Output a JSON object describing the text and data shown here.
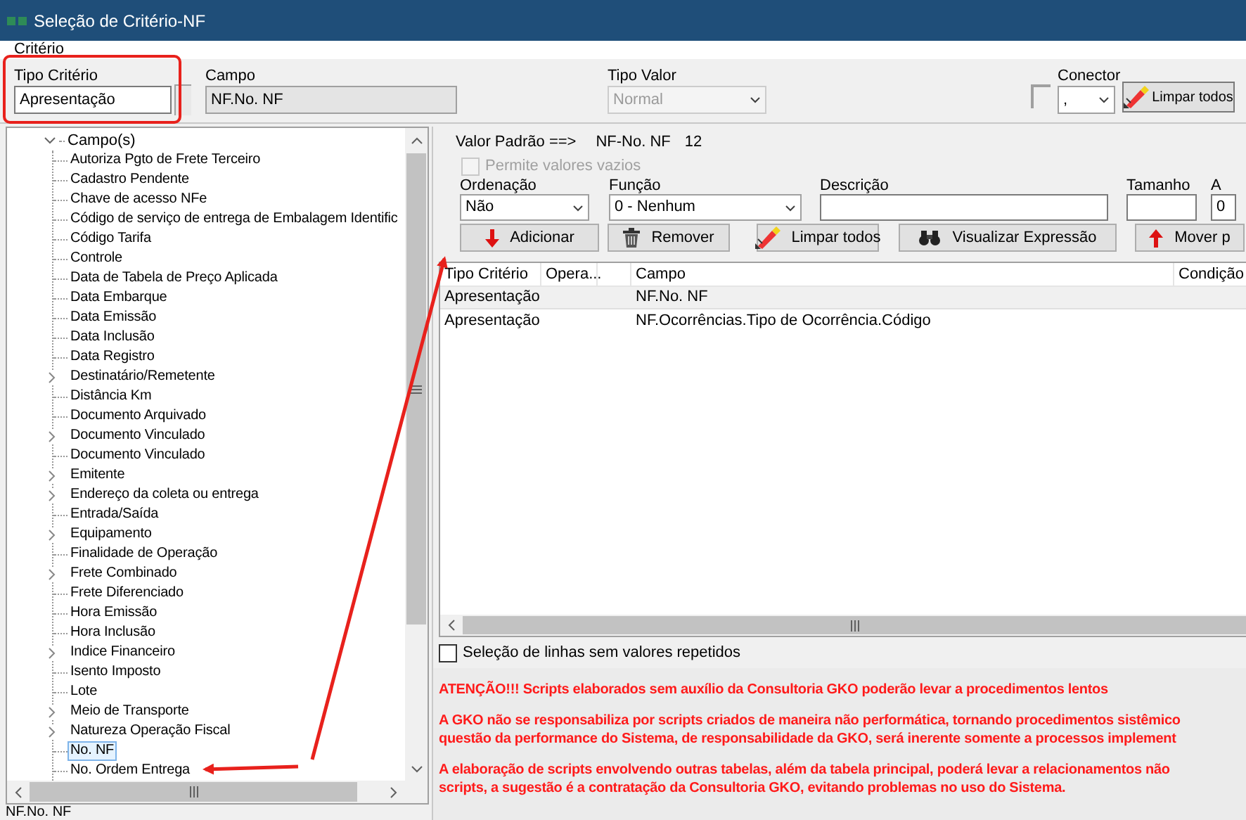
{
  "window": {
    "title": "Seleção de Critério-NF"
  },
  "menu": [
    {
      "label": "Critério"
    }
  ],
  "top_form": {
    "tipo_criterio": {
      "label": "Tipo Critério",
      "value": "Apresentação"
    },
    "campo": {
      "label": "Campo",
      "value": "NF.No. NF"
    },
    "tipo_valor": {
      "label": "Tipo Valor",
      "value": "Normal",
      "disabled": true
    },
    "conector": {
      "label": "Conector",
      "checked": false,
      "value": ","
    },
    "clear_button": {
      "label": "Limpar todos"
    }
  },
  "tree": {
    "label": "Campo(s)",
    "expanded": true,
    "children": [
      {
        "label": "Autoriza Pgto de Frete Terceiro",
        "expandable": false,
        "selected": false
      },
      {
        "label": "Cadastro Pendente",
        "expandable": false,
        "selected": false
      },
      {
        "label": "Chave de acesso NFe",
        "expandable": false,
        "selected": false
      },
      {
        "label": "Código de serviço de entrega de Embalagem Identific",
        "expandable": false,
        "selected": false
      },
      {
        "label": "Código Tarifa",
        "expandable": false,
        "selected": false
      },
      {
        "label": "Controle",
        "expandable": false,
        "selected": false
      },
      {
        "label": "Data de Tabela de Preço Aplicada",
        "expandable": false,
        "selected": false
      },
      {
        "label": "Data Embarque",
        "expandable": false,
        "selected": false
      },
      {
        "label": "Data Emissão",
        "expandable": false,
        "selected": false
      },
      {
        "label": "Data Inclusão",
        "expandable": false,
        "selected": false
      },
      {
        "label": "Data Registro",
        "expandable": false,
        "selected": false
      },
      {
        "label": "Destinatário/Remetente",
        "expandable": true,
        "selected": false
      },
      {
        "label": "Distância Km",
        "expandable": false,
        "selected": false
      },
      {
        "label": "Documento Arquivado",
        "expandable": false,
        "selected": false
      },
      {
        "label": "Documento Vinculado",
        "expandable": true,
        "selected": false
      },
      {
        "label": "Documento Vinculado",
        "expandable": false,
        "selected": false
      },
      {
        "label": "Emitente",
        "expandable": true,
        "selected": false
      },
      {
        "label": "Endereço da coleta ou entrega",
        "expandable": true,
        "selected": false
      },
      {
        "label": "Entrada/Saída",
        "expandable": false,
        "selected": false
      },
      {
        "label": "Equipamento",
        "expandable": true,
        "selected": false
      },
      {
        "label": "Finalidade de Operação",
        "expandable": false,
        "selected": false
      },
      {
        "label": "Frete Combinado",
        "expandable": true,
        "selected": false
      },
      {
        "label": "Frete Diferenciado",
        "expandable": false,
        "selected": false
      },
      {
        "label": "Hora Emissão",
        "expandable": false,
        "selected": false
      },
      {
        "label": "Hora Inclusão",
        "expandable": false,
        "selected": false
      },
      {
        "label": "Indice Financeiro",
        "expandable": true,
        "selected": false
      },
      {
        "label": "Isento Imposto",
        "expandable": false,
        "selected": false
      },
      {
        "label": "Lote",
        "expandable": false,
        "selected": false
      },
      {
        "label": "Meio de Transporte",
        "expandable": true,
        "selected": false
      },
      {
        "label": "Natureza Operação Fiscal",
        "expandable": true,
        "selected": false
      },
      {
        "label": "No. NF",
        "expandable": false,
        "selected": true
      },
      {
        "label": "No. Ordem Entrega",
        "expandable": false,
        "selected": false
      }
    ]
  },
  "status_text": "NF.No. NF",
  "default_value": {
    "label": "Valor Padrão ==>",
    "field": "NF-No. NF",
    "value": "12"
  },
  "allow_empty": {
    "label": "Permite valores vazios",
    "checked": false,
    "disabled": true
  },
  "fields": [
    {
      "kind": "select",
      "label": "Ordenação",
      "value": "Não"
    },
    {
      "kind": "select",
      "label": "Função",
      "value": "0 - Nenhum"
    },
    {
      "kind": "input",
      "label": "Descrição"
    },
    {
      "kind": "input",
      "label": "Tamanho"
    },
    {
      "kind": "input",
      "label": "A",
      "value": "0"
    }
  ],
  "buttons": [
    {
      "kind": "add",
      "label": "Adicionar"
    },
    {
      "kind": "remove",
      "label": "Remover"
    },
    {
      "kind": "clear",
      "label": "Limpar todos"
    },
    {
      "kind": "view",
      "label": "Visualizar Expressão"
    },
    {
      "kind": "move",
      "label": "Mover p"
    }
  ],
  "table": {
    "columns": [
      "Tipo Critério",
      "Opera...",
      "Campo",
      "Condição"
    ],
    "rows": [
      {
        "tipo_criterio": "Apresentação",
        "campo": "NF.No. NF",
        "selected": true
      },
      {
        "tipo_criterio": "Apresentação",
        "campo": "NF.Ocorrências.Tipo de Ocorrência.Código",
        "selected": false
      }
    ]
  },
  "distinct_rows": {
    "label": "Seleção de linhas sem valores repetidos",
    "checked": false
  },
  "warnings": [
    [
      "ATENÇÃO!!! Scripts elaborados sem auxílio da Consultoria GKO poderão levar a procedimentos lentos"
    ],
    [
      "A GKO não se responsabiliza por scripts criados de maneira não performática, tornando procedimentos sistêmico",
      "questão da performance do Sistema, de responsabilidade da GKO, será inerente somente a processos implement"
    ],
    [
      "A elaboração de scripts envolvendo outras tabelas, além da tabela principal, poderá levar a relacionamentos não",
      "scripts, a sugestão é a contratação da Consultoria GKO, evitando problemas no uso do Sistema."
    ]
  ]
}
